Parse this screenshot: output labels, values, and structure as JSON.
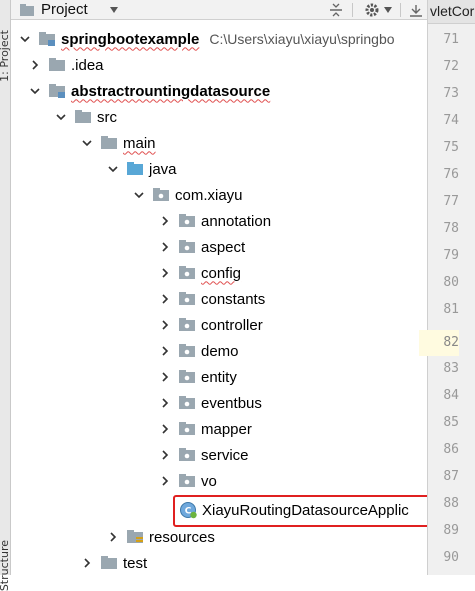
{
  "side_strip": {
    "project_label": "1: Project",
    "structure_label": "Structure"
  },
  "panel": {
    "title": "Project",
    "icons": [
      "dropdown-arrow-icon",
      "collapse-all-icon",
      "settings-icon",
      "hide-icon"
    ]
  },
  "tree": {
    "root": {
      "name": "springbootexample",
      "path": "C:\\Users\\xiayu\\xiayu\\springbo"
    },
    "idea": ".idea",
    "module": "abstractrountingdatasource",
    "src": "src",
    "main": "main",
    "java": "java",
    "package": "com.xiayu",
    "packages": [
      "annotation",
      "aspect",
      "config",
      "constants",
      "controller",
      "demo",
      "entity",
      "eventbus",
      "mapper",
      "service",
      "vo"
    ],
    "app_class": "XiayuRoutingDatasourceApplic",
    "resources": "resources",
    "test": "test"
  },
  "editor": {
    "tab_label": "vletCor",
    "line_numbers": [
      "71",
      "72",
      "73",
      "74",
      "75",
      "76",
      "77",
      "78",
      "79",
      "80",
      "81",
      "82",
      "83",
      "84",
      "85",
      "86",
      "87",
      "88",
      "89",
      "90"
    ],
    "current_line": "82"
  },
  "colors": {
    "highlight": "#e02020",
    "folder": "#9aa7b0",
    "source_folder": "#58a7d6",
    "module": "#5b8fbe"
  }
}
